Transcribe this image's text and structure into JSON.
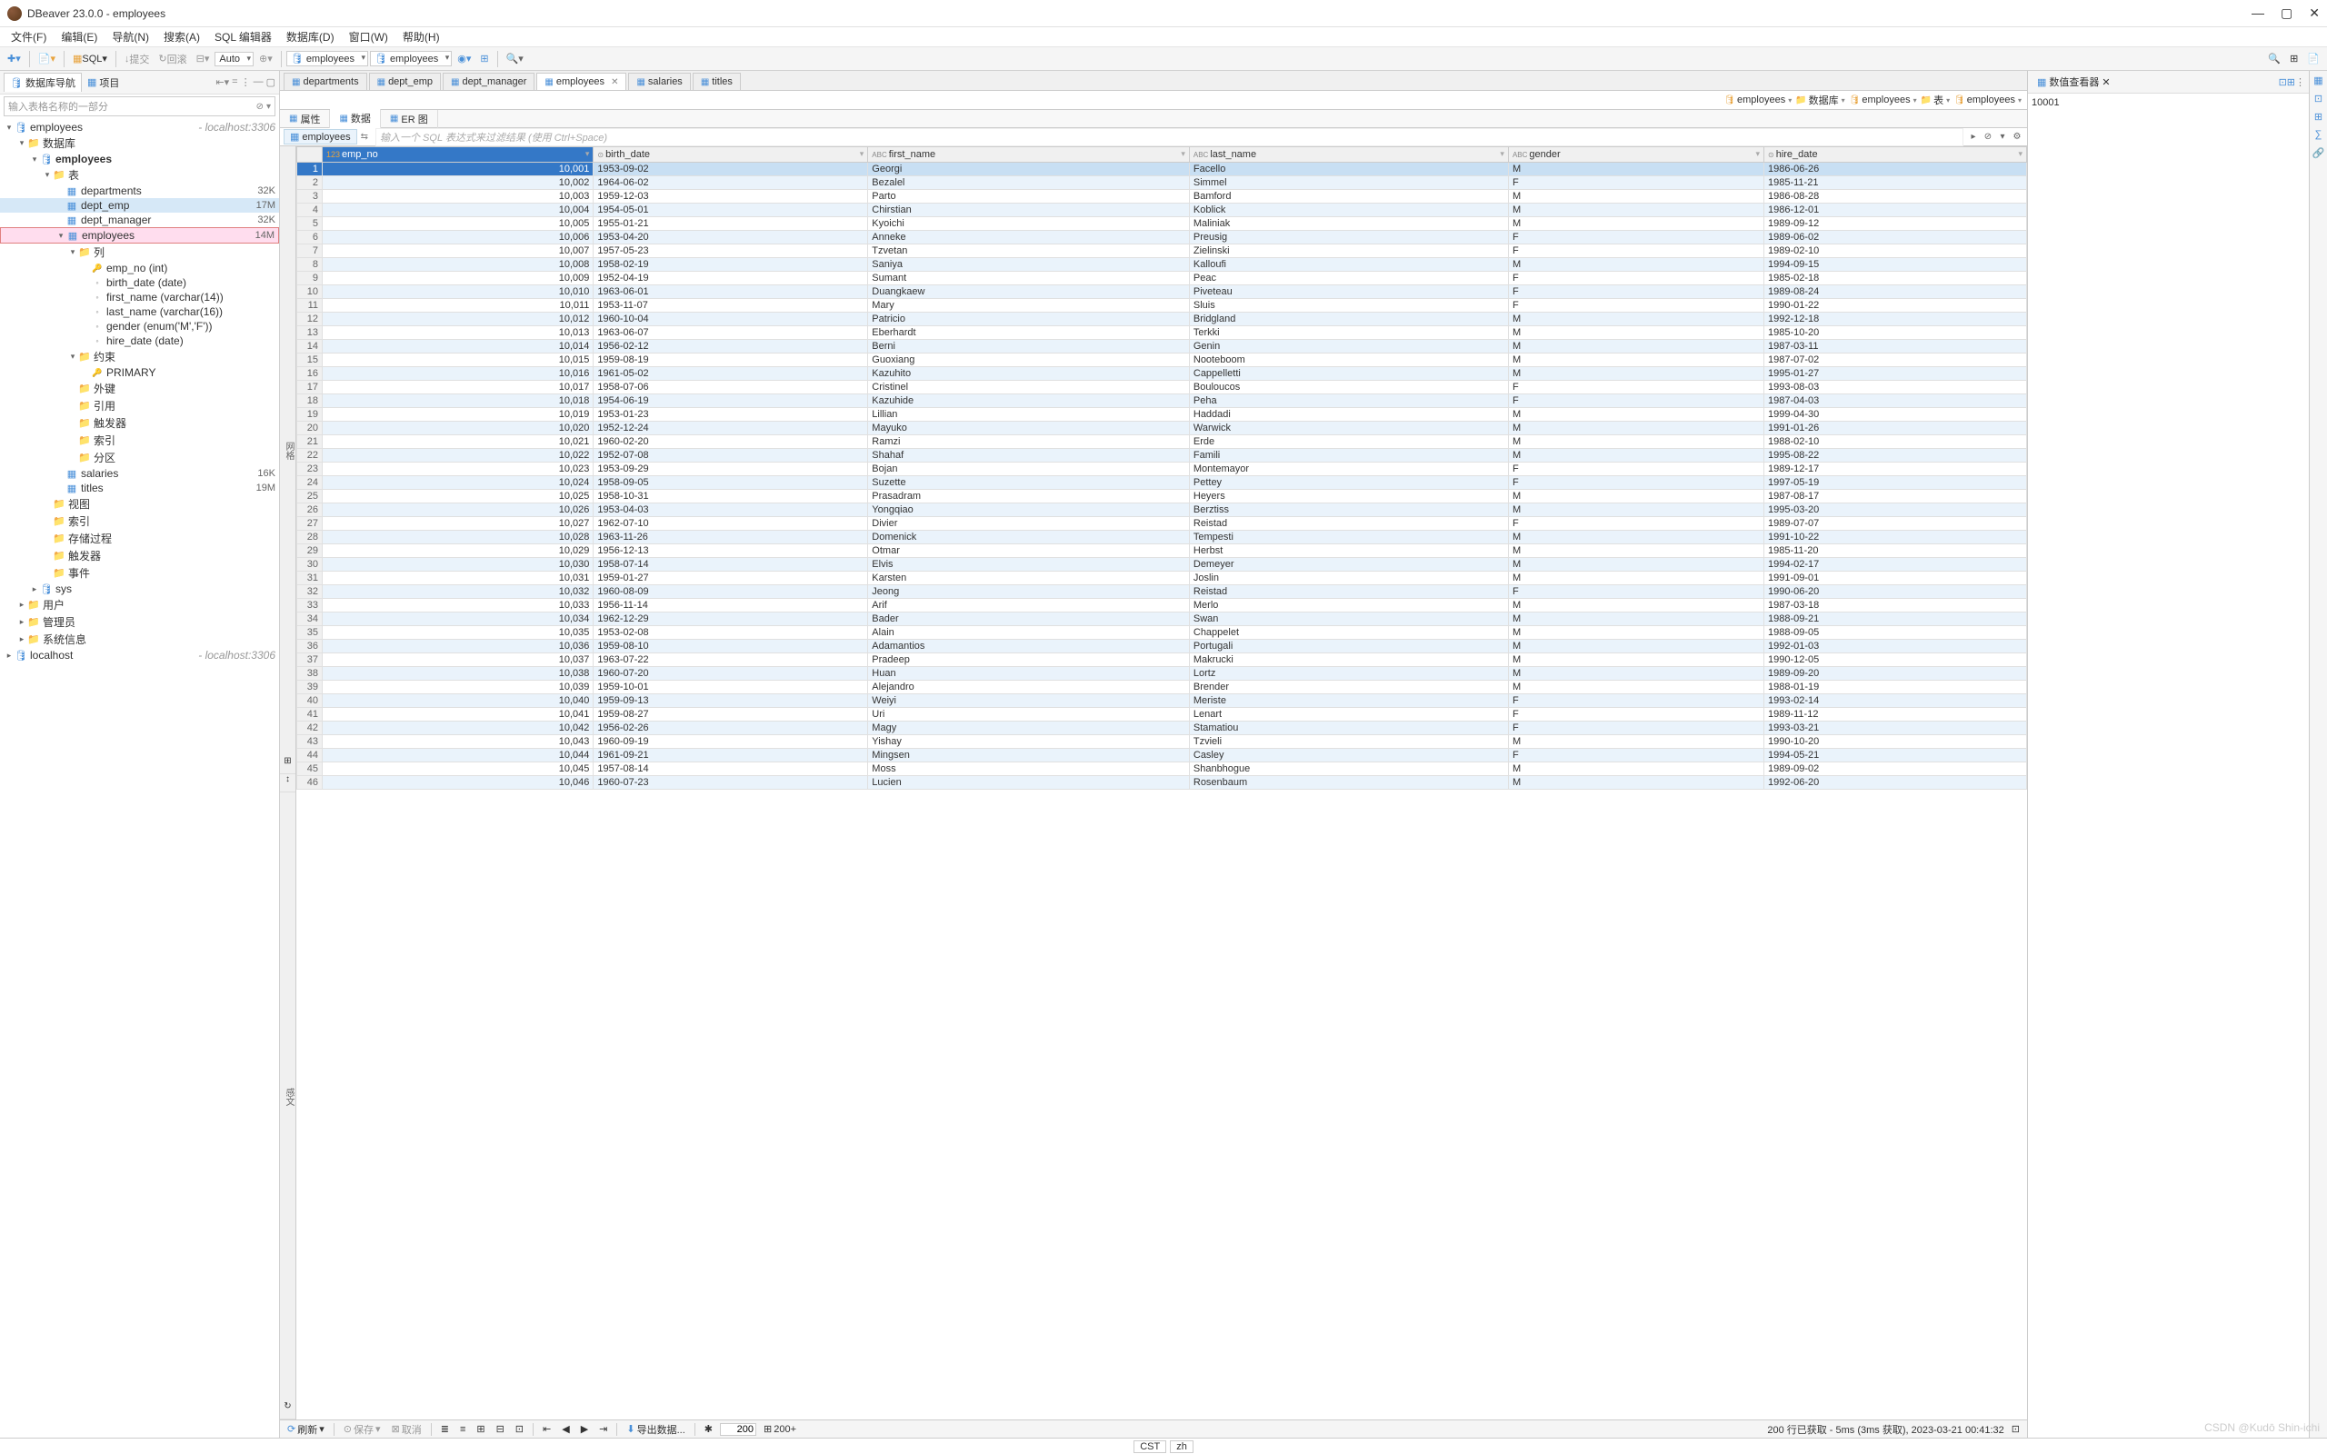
{
  "app": {
    "title": "DBeaver 23.0.0 - employees"
  },
  "menubar": [
    "文件(F)",
    "编辑(E)",
    "导航(N)",
    "搜索(A)",
    "SQL 编辑器",
    "数据库(D)",
    "窗口(W)",
    "帮助(H)"
  ],
  "toolbar": {
    "sql_label": "SQL",
    "commit": "提交",
    "rollback": "回滚",
    "auto": "Auto",
    "conn": "employees",
    "db": "employees"
  },
  "left": {
    "tab1": "数据库导航",
    "tab2": "项目",
    "filter_placeholder": "输入表格名称的一部分",
    "tree": [
      {
        "lvl": 0,
        "tog": "▾",
        "icon": "🛢",
        "label": "employees",
        "extra": "- localhost:3306"
      },
      {
        "lvl": 1,
        "tog": "▾",
        "icon": "📁",
        "label": "数据库"
      },
      {
        "lvl": 2,
        "tog": "▾",
        "icon": "🛢",
        "label": "employees",
        "bold": true
      },
      {
        "lvl": 3,
        "tog": "▾",
        "icon": "📁",
        "label": "表"
      },
      {
        "lvl": 4,
        "tog": "",
        "icon": "▦",
        "label": "departments",
        "count": "32K"
      },
      {
        "lvl": 4,
        "tog": "",
        "icon": "▦",
        "label": "dept_emp",
        "count": "17M",
        "sel": true
      },
      {
        "lvl": 4,
        "tog": "",
        "icon": "▦",
        "label": "dept_manager",
        "count": "32K"
      },
      {
        "lvl": 4,
        "tog": "▾",
        "icon": "▦",
        "label": "employees",
        "count": "14M",
        "hl": true
      },
      {
        "lvl": 5,
        "tog": "▾",
        "icon": "📁",
        "label": "列"
      },
      {
        "lvl": 6,
        "tog": "",
        "icon": "🔑",
        "label": "emp_no (int)"
      },
      {
        "lvl": 6,
        "tog": "",
        "icon": "◦",
        "label": "birth_date (date)"
      },
      {
        "lvl": 6,
        "tog": "",
        "icon": "◦",
        "label": "first_name (varchar(14))"
      },
      {
        "lvl": 6,
        "tog": "",
        "icon": "◦",
        "label": "last_name (varchar(16))"
      },
      {
        "lvl": 6,
        "tog": "",
        "icon": "◦",
        "label": "gender (enum('M','F'))"
      },
      {
        "lvl": 6,
        "tog": "",
        "icon": "◦",
        "label": "hire_date (date)"
      },
      {
        "lvl": 5,
        "tog": "▾",
        "icon": "📁",
        "label": "约束"
      },
      {
        "lvl": 6,
        "tog": "",
        "icon": "🔑",
        "label": "PRIMARY"
      },
      {
        "lvl": 5,
        "tog": "",
        "icon": "📁",
        "label": "外键"
      },
      {
        "lvl": 5,
        "tog": "",
        "icon": "📁",
        "label": "引用"
      },
      {
        "lvl": 5,
        "tog": "",
        "icon": "📁",
        "label": "触发器"
      },
      {
        "lvl": 5,
        "tog": "",
        "icon": "📁",
        "label": "索引"
      },
      {
        "lvl": 5,
        "tog": "",
        "icon": "📁",
        "label": "分区"
      },
      {
        "lvl": 4,
        "tog": "",
        "icon": "▦",
        "label": "salaries",
        "count": "16K"
      },
      {
        "lvl": 4,
        "tog": "",
        "icon": "▦",
        "label": "titles",
        "count": "19M"
      },
      {
        "lvl": 3,
        "tog": "",
        "icon": "📁",
        "label": "视图"
      },
      {
        "lvl": 3,
        "tog": "",
        "icon": "📁",
        "label": "索引"
      },
      {
        "lvl": 3,
        "tog": "",
        "icon": "📁",
        "label": "存储过程"
      },
      {
        "lvl": 3,
        "tog": "",
        "icon": "📁",
        "label": "触发器"
      },
      {
        "lvl": 3,
        "tog": "",
        "icon": "📁",
        "label": "事件"
      },
      {
        "lvl": 2,
        "tog": "▸",
        "icon": "🛢",
        "label": "sys"
      },
      {
        "lvl": 1,
        "tog": "▸",
        "icon": "📁",
        "label": "用户"
      },
      {
        "lvl": 1,
        "tog": "▸",
        "icon": "📁",
        "label": "管理员"
      },
      {
        "lvl": 1,
        "tog": "▸",
        "icon": "📁",
        "label": "系统信息"
      },
      {
        "lvl": 0,
        "tog": "▸",
        "icon": "🛢",
        "label": "localhost",
        "extra": "- localhost:3306"
      }
    ]
  },
  "editor": {
    "tabs": [
      {
        "label": "departments"
      },
      {
        "label": "dept_emp"
      },
      {
        "label": "dept_manager"
      },
      {
        "label": "employees",
        "active": true,
        "close": true
      },
      {
        "label": "salaries"
      },
      {
        "label": "titles"
      }
    ],
    "subtabs": [
      {
        "label": "属性"
      },
      {
        "label": "数据",
        "active": true
      },
      {
        "label": "ER 图"
      }
    ],
    "crumb": "employees",
    "sql_hint": "输入一个 SQL 表达式来过滤结果 (使用 Ctrl+Space)"
  },
  "topright_crumbs": [
    "employees",
    "数据库",
    "employees",
    "表",
    "employees"
  ],
  "grid": {
    "vside": "网格",
    "vbottom": "感文",
    "cols": [
      "emp_no",
      "birth_date",
      "first_name",
      "last_name",
      "gender",
      "hire_date"
    ],
    "rows": [
      [
        10001,
        "1953-09-02",
        "Georgi",
        "Facello",
        "M",
        "1986-06-26"
      ],
      [
        10002,
        "1964-06-02",
        "Bezalel",
        "Simmel",
        "F",
        "1985-11-21"
      ],
      [
        10003,
        "1959-12-03",
        "Parto",
        "Bamford",
        "M",
        "1986-08-28"
      ],
      [
        10004,
        "1954-05-01",
        "Chirstian",
        "Koblick",
        "M",
        "1986-12-01"
      ],
      [
        10005,
        "1955-01-21",
        "Kyoichi",
        "Maliniak",
        "M",
        "1989-09-12"
      ],
      [
        10006,
        "1953-04-20",
        "Anneke",
        "Preusig",
        "F",
        "1989-06-02"
      ],
      [
        10007,
        "1957-05-23",
        "Tzvetan",
        "Zielinski",
        "F",
        "1989-02-10"
      ],
      [
        10008,
        "1958-02-19",
        "Saniya",
        "Kalloufi",
        "M",
        "1994-09-15"
      ],
      [
        10009,
        "1952-04-19",
        "Sumant",
        "Peac",
        "F",
        "1985-02-18"
      ],
      [
        10010,
        "1963-06-01",
        "Duangkaew",
        "Piveteau",
        "F",
        "1989-08-24"
      ],
      [
        10011,
        "1953-11-07",
        "Mary",
        "Sluis",
        "F",
        "1990-01-22"
      ],
      [
        10012,
        "1960-10-04",
        "Patricio",
        "Bridgland",
        "M",
        "1992-12-18"
      ],
      [
        10013,
        "1963-06-07",
        "Eberhardt",
        "Terkki",
        "M",
        "1985-10-20"
      ],
      [
        10014,
        "1956-02-12",
        "Berni",
        "Genin",
        "M",
        "1987-03-11"
      ],
      [
        10015,
        "1959-08-19",
        "Guoxiang",
        "Nooteboom",
        "M",
        "1987-07-02"
      ],
      [
        10016,
        "1961-05-02",
        "Kazuhito",
        "Cappelletti",
        "M",
        "1995-01-27"
      ],
      [
        10017,
        "1958-07-06",
        "Cristinel",
        "Bouloucos",
        "F",
        "1993-08-03"
      ],
      [
        10018,
        "1954-06-19",
        "Kazuhide",
        "Peha",
        "F",
        "1987-04-03"
      ],
      [
        10019,
        "1953-01-23",
        "Lillian",
        "Haddadi",
        "M",
        "1999-04-30"
      ],
      [
        10020,
        "1952-12-24",
        "Mayuko",
        "Warwick",
        "M",
        "1991-01-26"
      ],
      [
        10021,
        "1960-02-20",
        "Ramzi",
        "Erde",
        "M",
        "1988-02-10"
      ],
      [
        10022,
        "1952-07-08",
        "Shahaf",
        "Famili",
        "M",
        "1995-08-22"
      ],
      [
        10023,
        "1953-09-29",
        "Bojan",
        "Montemayor",
        "F",
        "1989-12-17"
      ],
      [
        10024,
        "1958-09-05",
        "Suzette",
        "Pettey",
        "F",
        "1997-05-19"
      ],
      [
        10025,
        "1958-10-31",
        "Prasadram",
        "Heyers",
        "M",
        "1987-08-17"
      ],
      [
        10026,
        "1953-04-03",
        "Yongqiao",
        "Berztiss",
        "M",
        "1995-03-20"
      ],
      [
        10027,
        "1962-07-10",
        "Divier",
        "Reistad",
        "F",
        "1989-07-07"
      ],
      [
        10028,
        "1963-11-26",
        "Domenick",
        "Tempesti",
        "M",
        "1991-10-22"
      ],
      [
        10029,
        "1956-12-13",
        "Otmar",
        "Herbst",
        "M",
        "1985-11-20"
      ],
      [
        10030,
        "1958-07-14",
        "Elvis",
        "Demeyer",
        "M",
        "1994-02-17"
      ],
      [
        10031,
        "1959-01-27",
        "Karsten",
        "Joslin",
        "M",
        "1991-09-01"
      ],
      [
        10032,
        "1960-08-09",
        "Jeong",
        "Reistad",
        "F",
        "1990-06-20"
      ],
      [
        10033,
        "1956-11-14",
        "Arif",
        "Merlo",
        "M",
        "1987-03-18"
      ],
      [
        10034,
        "1962-12-29",
        "Bader",
        "Swan",
        "M",
        "1988-09-21"
      ],
      [
        10035,
        "1953-02-08",
        "Alain",
        "Chappelet",
        "M",
        "1988-09-05"
      ],
      [
        10036,
        "1959-08-10",
        "Adamantios",
        "Portugali",
        "M",
        "1992-01-03"
      ],
      [
        10037,
        "1963-07-22",
        "Pradeep",
        "Makrucki",
        "M",
        "1990-12-05"
      ],
      [
        10038,
        "1960-07-20",
        "Huan",
        "Lortz",
        "M",
        "1989-09-20"
      ],
      [
        10039,
        "1959-10-01",
        "Alejandro",
        "Brender",
        "M",
        "1988-01-19"
      ],
      [
        10040,
        "1959-09-13",
        "Weiyi",
        "Meriste",
        "F",
        "1993-02-14"
      ],
      [
        10041,
        "1959-08-27",
        "Uri",
        "Lenart",
        "F",
        "1989-11-12"
      ],
      [
        10042,
        "1956-02-26",
        "Magy",
        "Stamatiou",
        "F",
        "1993-03-21"
      ],
      [
        10043,
        "1960-09-19",
        "Yishay",
        "Tzvieli",
        "M",
        "1990-10-20"
      ],
      [
        10044,
        "1961-09-21",
        "Mingsen",
        "Casley",
        "F",
        "1994-05-21"
      ],
      [
        10045,
        "1957-08-14",
        "Moss",
        "Shanbhogue",
        "M",
        "1989-09-02"
      ],
      [
        10046,
        "1960-07-23",
        "Lucien",
        "Rosenbaum",
        "M",
        "1992-06-20"
      ]
    ]
  },
  "rightp": {
    "title": "数值查看器",
    "value": "10001"
  },
  "bottom": {
    "refresh": "刷新",
    "save": "保存",
    "cancel": "取消",
    "export": "导出数据...",
    "pagesize": "200",
    "more": "200+",
    "status": "200 行已获取 - 5ms (3ms 获取), 2023-03-21 00:41:32"
  },
  "status": {
    "tz": "CST",
    "locale": "zh"
  },
  "watermark": "CSDN @Kudō Shin-ichi"
}
